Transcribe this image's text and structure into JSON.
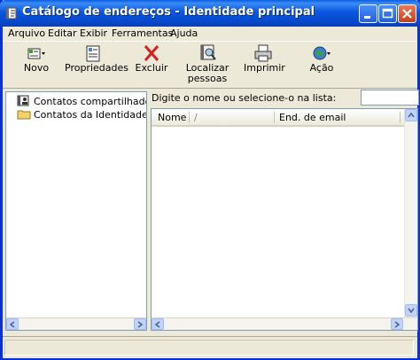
{
  "window": {
    "title": "Catálogo de endereços - Identidade principal"
  },
  "menu": [
    "Arquivo",
    "Editar",
    "Exibir",
    "Ferramentas",
    "Ajuda"
  ],
  "toolbar": {
    "novo": "Novo",
    "propriedades": "Propriedades",
    "excluir": "Excluir",
    "localizar_line1": "Localizar",
    "localizar_line2": "pessoas",
    "imprimir": "Imprimir",
    "acao": "Ação"
  },
  "tree": {
    "items": [
      {
        "label": "Contatos compartilhados",
        "icon": "shared-contacts-icon"
      },
      {
        "label": "Contatos da Identidade principal",
        "icon": "folder-icon"
      }
    ]
  },
  "search": {
    "prompt": "Digite o nome ou selecione-o na lista:",
    "value": ""
  },
  "list": {
    "columns": [
      "Nome",
      "End. de email"
    ],
    "sort_indicator": "/"
  },
  "colors": {
    "titlebar": "#0a5ce6",
    "window_face": "#ece9d8",
    "border": "#7f9db9"
  }
}
